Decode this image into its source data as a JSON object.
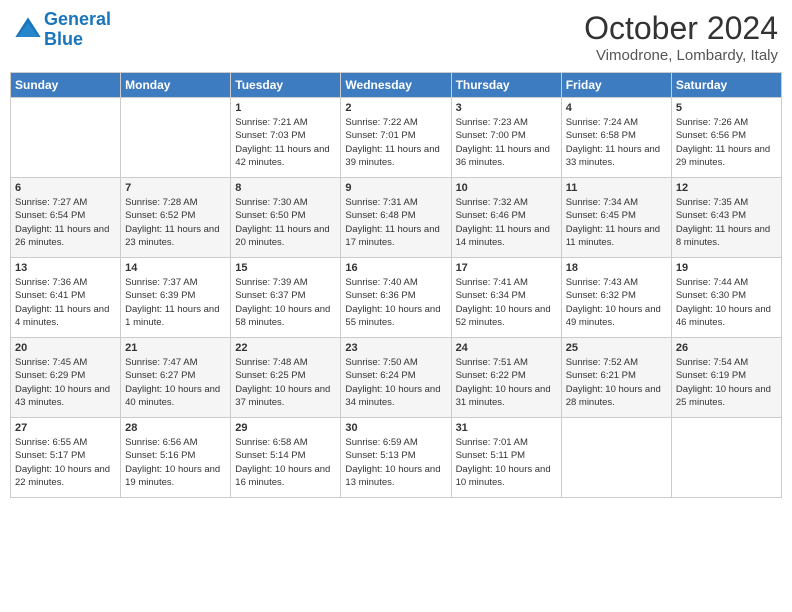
{
  "header": {
    "logo_line1": "General",
    "logo_line2": "Blue",
    "month": "October 2024",
    "location": "Vimodrone, Lombardy, Italy"
  },
  "weekdays": [
    "Sunday",
    "Monday",
    "Tuesday",
    "Wednesday",
    "Thursday",
    "Friday",
    "Saturday"
  ],
  "weeks": [
    [
      {
        "day": null,
        "sunrise": "",
        "sunset": "",
        "daylight": ""
      },
      {
        "day": null,
        "sunrise": "",
        "sunset": "",
        "daylight": ""
      },
      {
        "day": "1",
        "sunrise": "Sunrise: 7:21 AM",
        "sunset": "Sunset: 7:03 PM",
        "daylight": "Daylight: 11 hours and 42 minutes."
      },
      {
        "day": "2",
        "sunrise": "Sunrise: 7:22 AM",
        "sunset": "Sunset: 7:01 PM",
        "daylight": "Daylight: 11 hours and 39 minutes."
      },
      {
        "day": "3",
        "sunrise": "Sunrise: 7:23 AM",
        "sunset": "Sunset: 7:00 PM",
        "daylight": "Daylight: 11 hours and 36 minutes."
      },
      {
        "day": "4",
        "sunrise": "Sunrise: 7:24 AM",
        "sunset": "Sunset: 6:58 PM",
        "daylight": "Daylight: 11 hours and 33 minutes."
      },
      {
        "day": "5",
        "sunrise": "Sunrise: 7:26 AM",
        "sunset": "Sunset: 6:56 PM",
        "daylight": "Daylight: 11 hours and 29 minutes."
      }
    ],
    [
      {
        "day": "6",
        "sunrise": "Sunrise: 7:27 AM",
        "sunset": "Sunset: 6:54 PM",
        "daylight": "Daylight: 11 hours and 26 minutes."
      },
      {
        "day": "7",
        "sunrise": "Sunrise: 7:28 AM",
        "sunset": "Sunset: 6:52 PM",
        "daylight": "Daylight: 11 hours and 23 minutes."
      },
      {
        "day": "8",
        "sunrise": "Sunrise: 7:30 AM",
        "sunset": "Sunset: 6:50 PM",
        "daylight": "Daylight: 11 hours and 20 minutes."
      },
      {
        "day": "9",
        "sunrise": "Sunrise: 7:31 AM",
        "sunset": "Sunset: 6:48 PM",
        "daylight": "Daylight: 11 hours and 17 minutes."
      },
      {
        "day": "10",
        "sunrise": "Sunrise: 7:32 AM",
        "sunset": "Sunset: 6:46 PM",
        "daylight": "Daylight: 11 hours and 14 minutes."
      },
      {
        "day": "11",
        "sunrise": "Sunrise: 7:34 AM",
        "sunset": "Sunset: 6:45 PM",
        "daylight": "Daylight: 11 hours and 11 minutes."
      },
      {
        "day": "12",
        "sunrise": "Sunrise: 7:35 AM",
        "sunset": "Sunset: 6:43 PM",
        "daylight": "Daylight: 11 hours and 8 minutes."
      }
    ],
    [
      {
        "day": "13",
        "sunrise": "Sunrise: 7:36 AM",
        "sunset": "Sunset: 6:41 PM",
        "daylight": "Daylight: 11 hours and 4 minutes."
      },
      {
        "day": "14",
        "sunrise": "Sunrise: 7:37 AM",
        "sunset": "Sunset: 6:39 PM",
        "daylight": "Daylight: 11 hours and 1 minute."
      },
      {
        "day": "15",
        "sunrise": "Sunrise: 7:39 AM",
        "sunset": "Sunset: 6:37 PM",
        "daylight": "Daylight: 10 hours and 58 minutes."
      },
      {
        "day": "16",
        "sunrise": "Sunrise: 7:40 AM",
        "sunset": "Sunset: 6:36 PM",
        "daylight": "Daylight: 10 hours and 55 minutes."
      },
      {
        "day": "17",
        "sunrise": "Sunrise: 7:41 AM",
        "sunset": "Sunset: 6:34 PM",
        "daylight": "Daylight: 10 hours and 52 minutes."
      },
      {
        "day": "18",
        "sunrise": "Sunrise: 7:43 AM",
        "sunset": "Sunset: 6:32 PM",
        "daylight": "Daylight: 10 hours and 49 minutes."
      },
      {
        "day": "19",
        "sunrise": "Sunrise: 7:44 AM",
        "sunset": "Sunset: 6:30 PM",
        "daylight": "Daylight: 10 hours and 46 minutes."
      }
    ],
    [
      {
        "day": "20",
        "sunrise": "Sunrise: 7:45 AM",
        "sunset": "Sunset: 6:29 PM",
        "daylight": "Daylight: 10 hours and 43 minutes."
      },
      {
        "day": "21",
        "sunrise": "Sunrise: 7:47 AM",
        "sunset": "Sunset: 6:27 PM",
        "daylight": "Daylight: 10 hours and 40 minutes."
      },
      {
        "day": "22",
        "sunrise": "Sunrise: 7:48 AM",
        "sunset": "Sunset: 6:25 PM",
        "daylight": "Daylight: 10 hours and 37 minutes."
      },
      {
        "day": "23",
        "sunrise": "Sunrise: 7:50 AM",
        "sunset": "Sunset: 6:24 PM",
        "daylight": "Daylight: 10 hours and 34 minutes."
      },
      {
        "day": "24",
        "sunrise": "Sunrise: 7:51 AM",
        "sunset": "Sunset: 6:22 PM",
        "daylight": "Daylight: 10 hours and 31 minutes."
      },
      {
        "day": "25",
        "sunrise": "Sunrise: 7:52 AM",
        "sunset": "Sunset: 6:21 PM",
        "daylight": "Daylight: 10 hours and 28 minutes."
      },
      {
        "day": "26",
        "sunrise": "Sunrise: 7:54 AM",
        "sunset": "Sunset: 6:19 PM",
        "daylight": "Daylight: 10 hours and 25 minutes."
      }
    ],
    [
      {
        "day": "27",
        "sunrise": "Sunrise: 6:55 AM",
        "sunset": "Sunset: 5:17 PM",
        "daylight": "Daylight: 10 hours and 22 minutes."
      },
      {
        "day": "28",
        "sunrise": "Sunrise: 6:56 AM",
        "sunset": "Sunset: 5:16 PM",
        "daylight": "Daylight: 10 hours and 19 minutes."
      },
      {
        "day": "29",
        "sunrise": "Sunrise: 6:58 AM",
        "sunset": "Sunset: 5:14 PM",
        "daylight": "Daylight: 10 hours and 16 minutes."
      },
      {
        "day": "30",
        "sunrise": "Sunrise: 6:59 AM",
        "sunset": "Sunset: 5:13 PM",
        "daylight": "Daylight: 10 hours and 13 minutes."
      },
      {
        "day": "31",
        "sunrise": "Sunrise: 7:01 AM",
        "sunset": "Sunset: 5:11 PM",
        "daylight": "Daylight: 10 hours and 10 minutes."
      },
      {
        "day": null,
        "sunrise": "",
        "sunset": "",
        "daylight": ""
      },
      {
        "day": null,
        "sunrise": "",
        "sunset": "",
        "daylight": ""
      }
    ]
  ]
}
